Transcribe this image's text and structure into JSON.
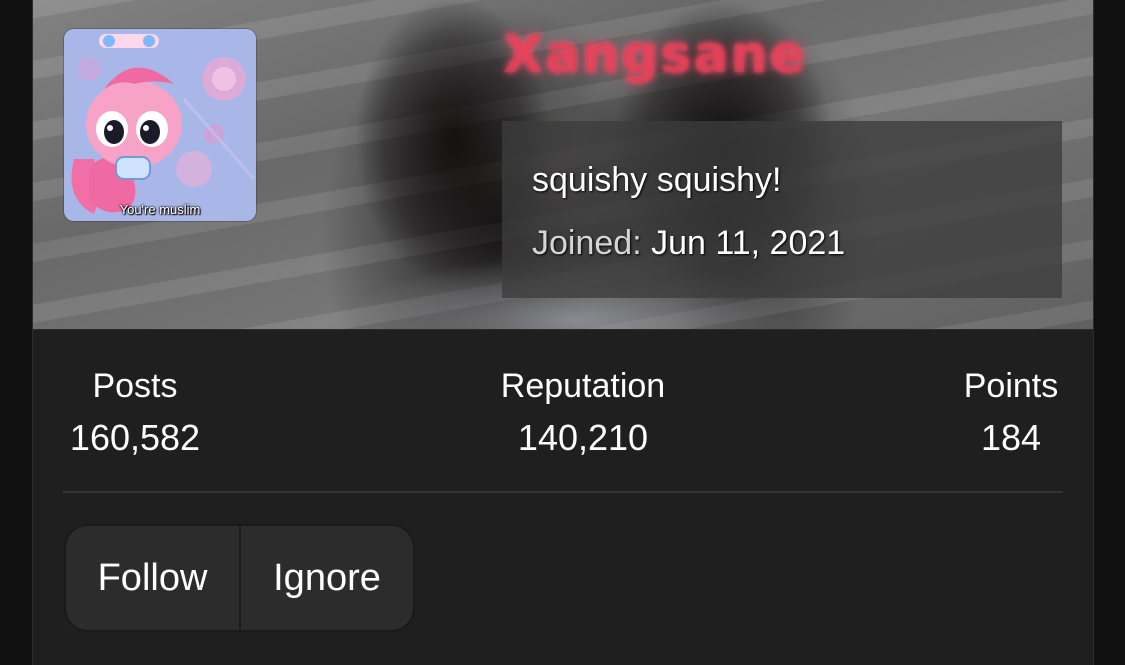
{
  "profile": {
    "username": "Xangsane",
    "avatar_caption": "You're muslim",
    "status": "squishy squishy!",
    "joined_label": "Joined:",
    "joined_value": "Jun 11, 2021"
  },
  "stats": {
    "posts_label": "Posts",
    "posts_value": "160,582",
    "reputation_label": "Reputation",
    "reputation_value": "140,210",
    "points_label": "Points",
    "points_value": "184"
  },
  "actions": {
    "follow_label": "Follow",
    "ignore_label": "Ignore"
  },
  "colors": {
    "card_background": "#1f1f1f",
    "username_glow": "#ff5070",
    "button_background": "#2c2c2c"
  }
}
